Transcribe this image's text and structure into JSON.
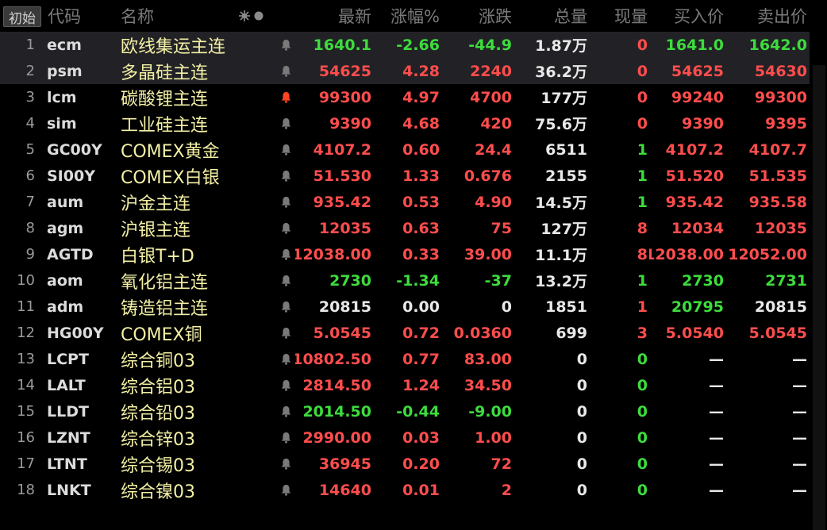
{
  "header": {
    "reset_button": "初始",
    "columns": {
      "code": "代码",
      "name": "名称",
      "last": "最新",
      "pct": "涨幅%",
      "chg": "涨跌",
      "vol": "总量",
      "cur": "现量",
      "bid": "买入价",
      "ask": "卖出价"
    }
  },
  "colors": {
    "up": "#ff4d4d",
    "down": "#3ddc3d",
    "flat": "#e8e8e8",
    "name": "#f3f0a5",
    "alert": "#ff4422"
  },
  "icons": {
    "settings": "settings-icon",
    "bell": "bell-icon"
  },
  "rows": [
    {
      "num": "1",
      "code": "ecm",
      "name": "欧线集运主连",
      "last": "1640.1",
      "pct": "-2.66",
      "chg": "-44.9",
      "vol": "1.87万",
      "cur": "0",
      "bid": "1641.0",
      "ask": "1642.0",
      "dir": "down",
      "cur_dir": "up",
      "bid_dir": "down",
      "ask_dir": "down",
      "alert": false,
      "selected": true
    },
    {
      "num": "2",
      "code": "psm",
      "name": "多晶硅主连",
      "last": "54625",
      "pct": "4.28",
      "chg": "2240",
      "vol": "36.2万",
      "cur": "0",
      "bid": "54625",
      "ask": "54630",
      "dir": "up",
      "cur_dir": "up",
      "bid_dir": "up",
      "ask_dir": "up",
      "alert": false,
      "selected": true
    },
    {
      "num": "3",
      "code": "lcm",
      "name": "碳酸锂主连",
      "last": "99300",
      "pct": "4.97",
      "chg": "4700",
      "vol": "177万",
      "cur": "0",
      "bid": "99240",
      "ask": "99300",
      "dir": "up",
      "cur_dir": "up",
      "bid_dir": "up",
      "ask_dir": "up",
      "alert": true,
      "selected": false
    },
    {
      "num": "4",
      "code": "sim",
      "name": "工业硅主连",
      "last": "9390",
      "pct": "4.68",
      "chg": "420",
      "vol": "75.6万",
      "cur": "0",
      "bid": "9390",
      "ask": "9395",
      "dir": "up",
      "cur_dir": "up",
      "bid_dir": "up",
      "ask_dir": "up",
      "alert": false,
      "selected": false
    },
    {
      "num": "5",
      "code": "GC00Y",
      "name": "COMEX黄金",
      "last": "4107.2",
      "pct": "0.60",
      "chg": "24.4",
      "vol": "6511",
      "cur": "1",
      "bid": "4107.2",
      "ask": "4107.7",
      "dir": "up",
      "cur_dir": "down",
      "bid_dir": "up",
      "ask_dir": "up",
      "alert": false,
      "selected": false
    },
    {
      "num": "6",
      "code": "SI00Y",
      "name": "COMEX白银",
      "last": "51.530",
      "pct": "1.33",
      "chg": "0.676",
      "vol": "2155",
      "cur": "1",
      "bid": "51.520",
      "ask": "51.535",
      "dir": "up",
      "cur_dir": "down",
      "bid_dir": "up",
      "ask_dir": "up",
      "alert": false,
      "selected": false
    },
    {
      "num": "7",
      "code": "aum",
      "name": "沪金主连",
      "last": "935.42",
      "pct": "0.53",
      "chg": "4.90",
      "vol": "14.5万",
      "cur": "1",
      "bid": "935.42",
      "ask": "935.58",
      "dir": "up",
      "cur_dir": "down",
      "bid_dir": "up",
      "ask_dir": "up",
      "alert": false,
      "selected": false
    },
    {
      "num": "8",
      "code": "agm",
      "name": "沪银主连",
      "last": "12035",
      "pct": "0.63",
      "chg": "75",
      "vol": "127万",
      "cur": "8",
      "bid": "12034",
      "ask": "12035",
      "dir": "up",
      "cur_dir": "up",
      "bid_dir": "up",
      "ask_dir": "up",
      "alert": false,
      "selected": false
    },
    {
      "num": "9",
      "code": "AGTD",
      "name": "白银T+D",
      "last": "12038.00",
      "pct": "0.33",
      "chg": "39.00",
      "vol": "11.1万",
      "cur": "8",
      "bid": "12038.00",
      "ask": "12052.00",
      "dir": "up",
      "cur_dir": "up",
      "bid_dir": "up",
      "ask_dir": "up",
      "alert": false,
      "selected": false
    },
    {
      "num": "10",
      "code": "aom",
      "name": "氧化铝主连",
      "last": "2730",
      "pct": "-1.34",
      "chg": "-37",
      "vol": "13.2万",
      "cur": "1",
      "bid": "2730",
      "ask": "2731",
      "dir": "down",
      "cur_dir": "down",
      "bid_dir": "down",
      "ask_dir": "down",
      "alert": false,
      "selected": false
    },
    {
      "num": "11",
      "code": "adm",
      "name": "铸造铝主连",
      "last": "20815",
      "pct": "0.00",
      "chg": "0",
      "vol": "1851",
      "cur": "1",
      "bid": "20795",
      "ask": "20815",
      "dir": "flat",
      "cur_dir": "up",
      "bid_dir": "down",
      "ask_dir": "flat",
      "alert": false,
      "selected": false
    },
    {
      "num": "12",
      "code": "HG00Y",
      "name": "COMEX铜",
      "last": "5.0545",
      "pct": "0.72",
      "chg": "0.0360",
      "vol": "699",
      "cur": "3",
      "bid": "5.0540",
      "ask": "5.0545",
      "dir": "up",
      "cur_dir": "up",
      "bid_dir": "up",
      "ask_dir": "up",
      "alert": false,
      "selected": false
    },
    {
      "num": "13",
      "code": "LCPT",
      "name": "综合铜03",
      "last": "10802.50",
      "pct": "0.77",
      "chg": "83.00",
      "vol": "0",
      "cur": "0",
      "bid": "—",
      "ask": "—",
      "dir": "up",
      "cur_dir": "down",
      "bid_dir": "flat",
      "ask_dir": "flat",
      "alert": false,
      "selected": false
    },
    {
      "num": "14",
      "code": "LALT",
      "name": "综合铝03",
      "last": "2814.50",
      "pct": "1.24",
      "chg": "34.50",
      "vol": "0",
      "cur": "0",
      "bid": "—",
      "ask": "—",
      "dir": "up",
      "cur_dir": "down",
      "bid_dir": "flat",
      "ask_dir": "flat",
      "alert": false,
      "selected": false
    },
    {
      "num": "15",
      "code": "LLDT",
      "name": "综合铅03",
      "last": "2014.50",
      "pct": "-0.44",
      "chg": "-9.00",
      "vol": "0",
      "cur": "0",
      "bid": "—",
      "ask": "—",
      "dir": "down",
      "cur_dir": "down",
      "bid_dir": "flat",
      "ask_dir": "flat",
      "alert": false,
      "selected": false
    },
    {
      "num": "16",
      "code": "LZNT",
      "name": "综合锌03",
      "last": "2990.00",
      "pct": "0.03",
      "chg": "1.00",
      "vol": "0",
      "cur": "0",
      "bid": "—",
      "ask": "—",
      "dir": "up",
      "cur_dir": "down",
      "bid_dir": "flat",
      "ask_dir": "flat",
      "alert": false,
      "selected": false
    },
    {
      "num": "17",
      "code": "LTNT",
      "name": "综合锡03",
      "last": "36945",
      "pct": "0.20",
      "chg": "72",
      "vol": "0",
      "cur": "0",
      "bid": "—",
      "ask": "—",
      "dir": "up",
      "cur_dir": "down",
      "bid_dir": "flat",
      "ask_dir": "flat",
      "alert": false,
      "selected": false
    },
    {
      "num": "18",
      "code": "LNKT",
      "name": "综合镍03",
      "last": "14640",
      "pct": "0.01",
      "chg": "2",
      "vol": "0",
      "cur": "0",
      "bid": "—",
      "ask": "—",
      "dir": "up",
      "cur_dir": "down",
      "bid_dir": "flat",
      "ask_dir": "flat",
      "alert": false,
      "selected": false
    }
  ]
}
